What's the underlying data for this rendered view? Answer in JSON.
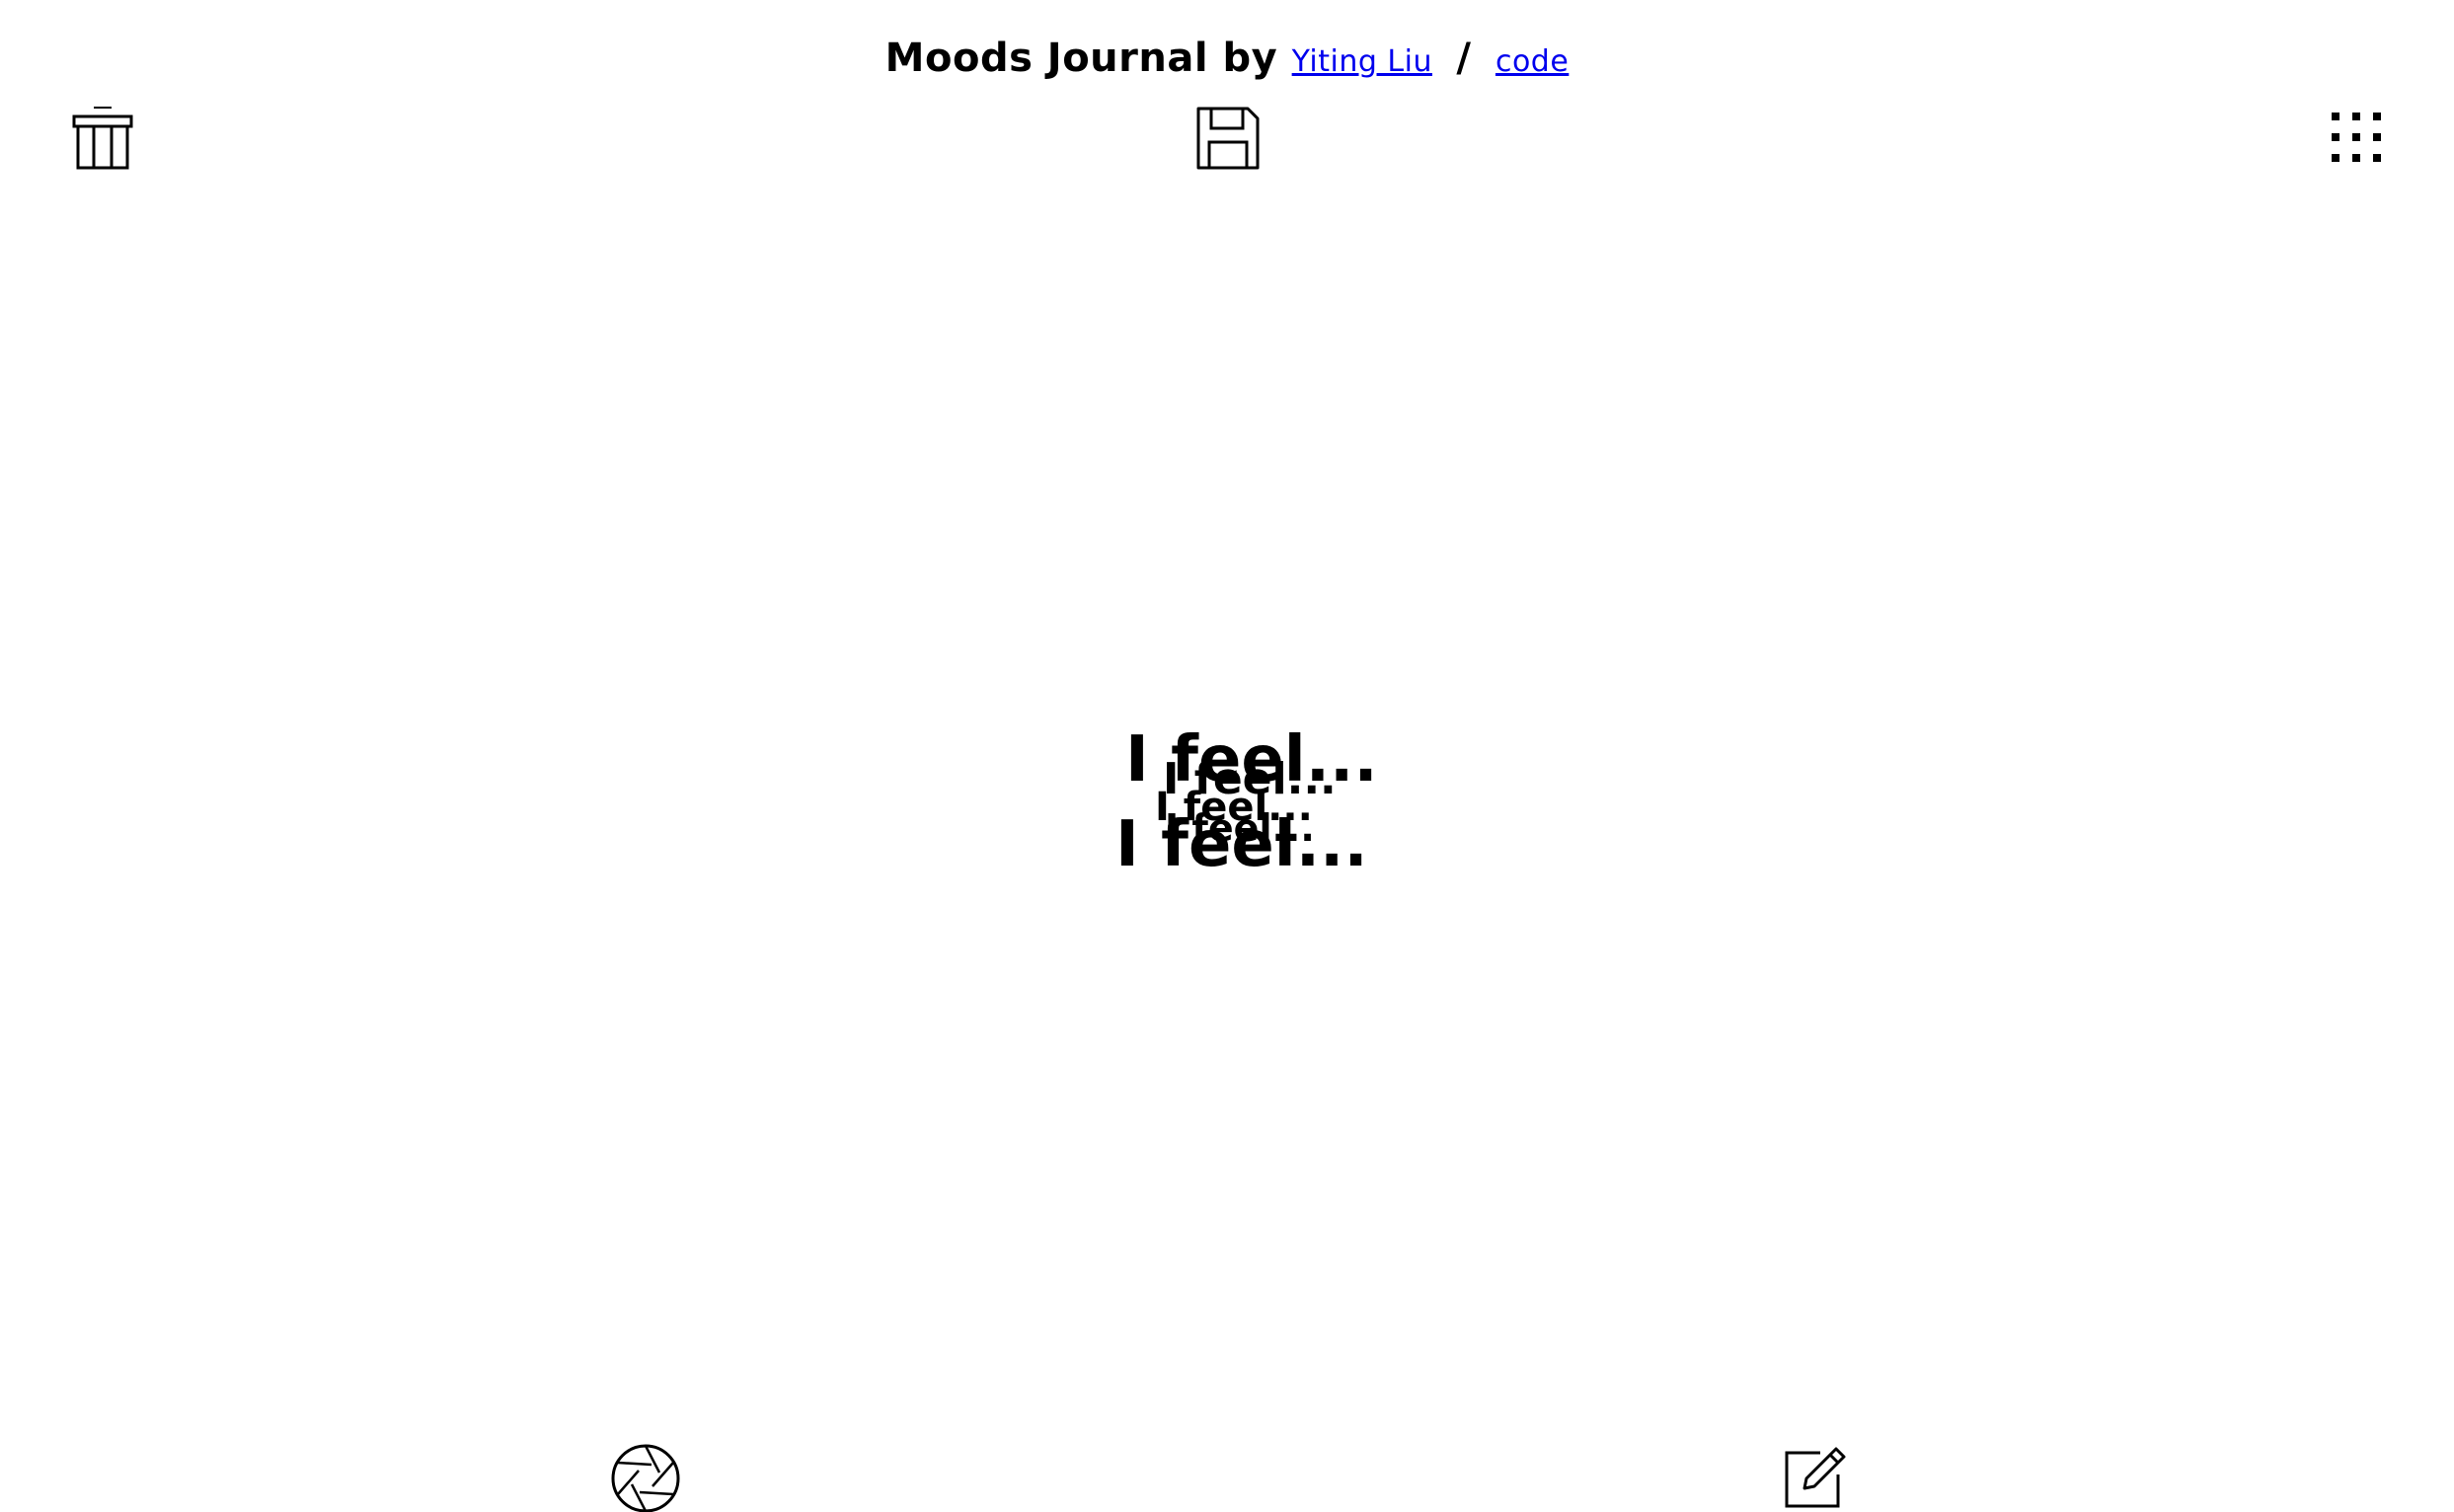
{
  "header": {
    "title": "Moods Journal by",
    "author_link": "Yiting Liu",
    "separator": "/",
    "code_link": "code"
  },
  "toolbar": {
    "delete_icon": "trash-icon",
    "save_icon": "save-icon",
    "gallery_icon": "grid-icon"
  },
  "canvas": {
    "mood_lines": [
      "I feel...",
      "I feel...",
      "I feel...",
      "I feel...",
      "I feel..."
    ]
  },
  "bottom_bar": {
    "capture_icon": "aperture-icon",
    "write_icon": "edit-icon"
  }
}
